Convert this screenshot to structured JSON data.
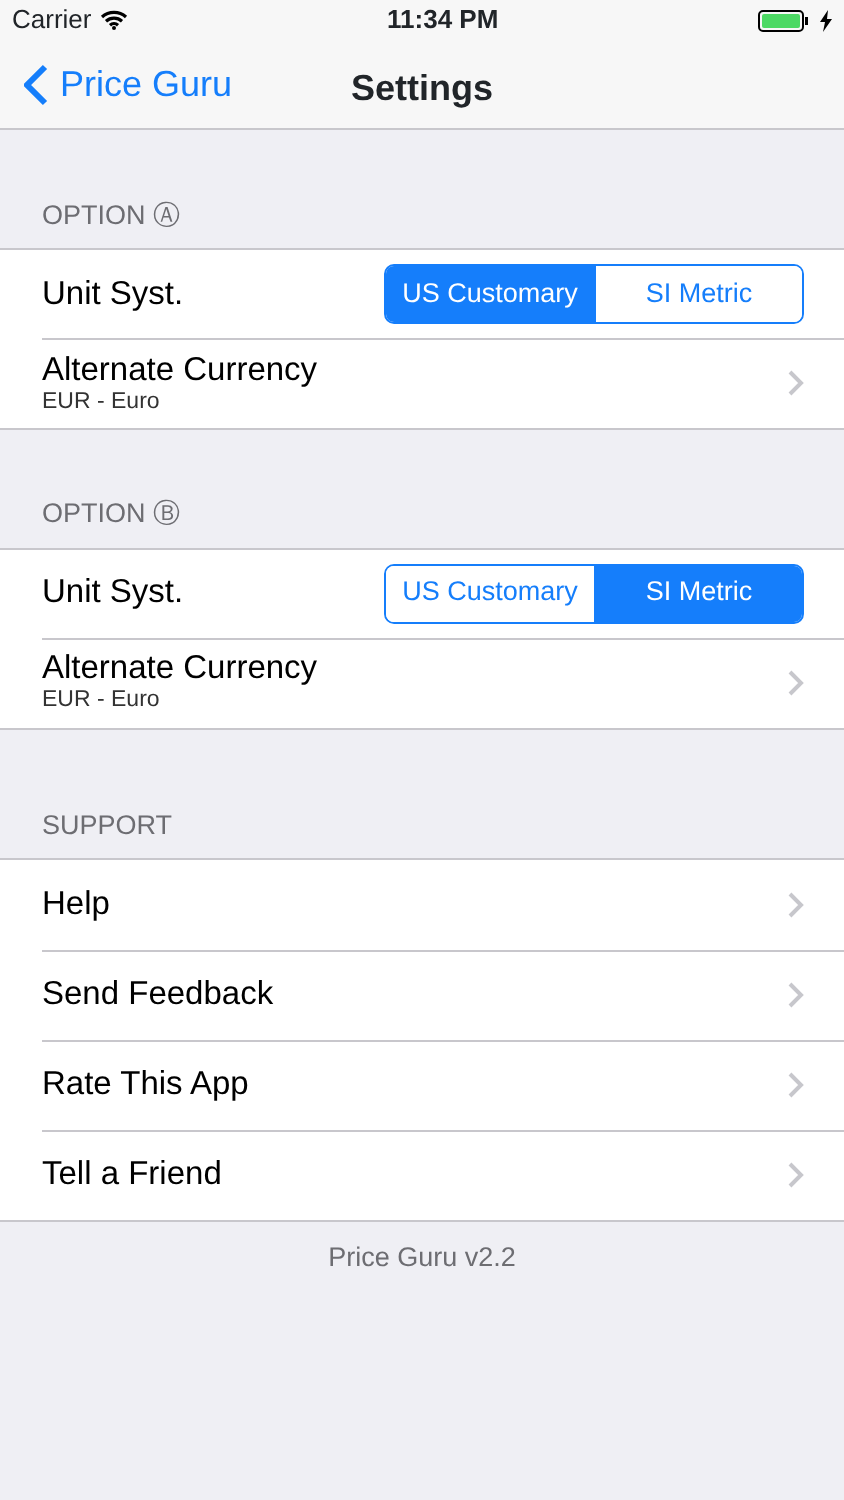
{
  "status_bar": {
    "carrier": "Carrier",
    "time": "11:34 PM",
    "charging": true
  },
  "nav": {
    "back": "Price Guru",
    "title": "Settings"
  },
  "sections": [
    {
      "header": "OPTION Ⓐ",
      "rows": [
        {
          "kind": "segmented",
          "label": "Unit Syst.",
          "segments": [
            {
              "label": "US Customary",
              "selected": true
            },
            {
              "label": "SI Metric",
              "selected": false
            }
          ]
        },
        {
          "kind": "detail",
          "label": "Alternate Currency",
          "detail": "EUR - Euro"
        }
      ]
    },
    {
      "header": "OPTION Ⓑ",
      "rows": [
        {
          "kind": "segmented",
          "label": "Unit Syst.",
          "segments": [
            {
              "label": "US Customary",
              "selected": false
            },
            {
              "label": "SI Metric",
              "selected": true
            }
          ]
        },
        {
          "kind": "detail",
          "label": "Alternate Currency",
          "detail": "EUR - Euro"
        }
      ]
    },
    {
      "header": "SUPPORT",
      "rows": [
        {
          "kind": "link",
          "label": "Help"
        },
        {
          "kind": "link",
          "label": "Send Feedback"
        },
        {
          "kind": "link",
          "label": "Rate This App"
        },
        {
          "kind": "link",
          "label": "Tell a Friend"
        }
      ]
    }
  ],
  "footer": "Price Guru v2.2"
}
